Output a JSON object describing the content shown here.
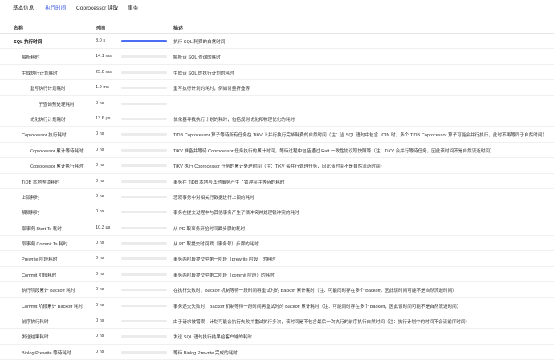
{
  "tabs": [
    {
      "label": "基本信息",
      "active": false
    },
    {
      "label": "执行时间",
      "active": true
    },
    {
      "label": "Coprocessor 读取",
      "active": false
    },
    {
      "label": "事务",
      "active": false
    }
  ],
  "columns": {
    "name": "名称",
    "time": "时间",
    "desc": "描述"
  },
  "accent_color": "#3b5bdb",
  "rows": [
    {
      "name": "SQL 执行时间",
      "time": "8.0 s",
      "progress": 1.0,
      "desc": "执行 SQL 耗费的自然时间",
      "bold": true
    },
    {
      "name": "解析耗时",
      "time": "14.1 ms",
      "progress": 0.0,
      "desc": "解析该 SQL 查询的耗时"
    },
    {
      "name": "生成执行计划耗时",
      "time": "25.0 ms",
      "progress": 0.0,
      "desc": "生成该 SQL 的执行计划的耗时"
    },
    {
      "name": "重写执行计划耗时",
      "time": "1.9 ms",
      "progress": 0.0,
      "desc": "重写执行计划的耗时，例如常量折叠等"
    },
    {
      "name": "子查询预处理耗时",
      "time": "0 ns",
      "progress": 0.0,
      "desc": ""
    },
    {
      "name": "优化执行计划耗时",
      "time": "13.6 µs",
      "progress": 0.0,
      "desc": "优化器寻找执行计划的耗时，包括规则优化和物理优化的耗时"
    },
    {
      "name": "Coprocessor 执行耗时",
      "time": "0 ns",
      "progress": 0.0,
      "desc": "TiDB Coprocessor 算子等待所有任务在 TiKV 上并行执行完毕耗费的自然时间（注：当 SQL 语句中包含 JOIN 时，多个 TiDB Coprocessor 算子可能会并行执行，此时不再等同于自然时间）"
    },
    {
      "name": "Coprocessor 累计等待耗时",
      "time": "0 ns",
      "progress": 0.0,
      "desc": "TiKV 准备并等待 Coprocessor 任务执行的累计时间，等待过程中包括通过 Raft 一致性协议取快照等（注：TiKV 会并行等待任务，因此该时间不是自然流逝时间）"
    },
    {
      "name": "Coprocessor 累计执行耗时",
      "time": "0 ns",
      "progress": 0.0,
      "desc": "TiKV 执行 Coprocessor 任务的累计处理时间（注：TiKV 会并行处理任务，因此该时间不是自然流逝时间）"
    },
    {
      "name": "TiDB 本地等锁耗时",
      "time": "0 ns",
      "progress": 0.0,
      "desc": "事务在 TiDB 本地与其他事务产生了锁冲突并等待的耗时"
    },
    {
      "name": "上锁耗时",
      "time": "0 ns",
      "progress": 0.0,
      "desc": "悲观事务中对相关行数据进行上锁的耗时"
    },
    {
      "name": "解锁耗时",
      "time": "0 ns",
      "progress": 0.0,
      "desc": "事务在提交过程中与其他事务产生了锁冲突并处理锁冲突的耗时"
    },
    {
      "name": "取事务 Start Ts 耗时",
      "time": "10.3 µs",
      "progress": 0.0,
      "desc": "从 PD 取事务开始时间戳步骤的耗时"
    },
    {
      "name": "取事务 Commit Ts 耗时",
      "time": "0 ns",
      "progress": 0.0,
      "desc": "从 PD 取提交时间戳（事务号）步骤的耗时"
    },
    {
      "name": "Prewrite 阶段耗时",
      "time": "0 ns",
      "progress": 0.0,
      "desc": "事务两阶段提交中第一阶段（prewrite 阶段）的耗时"
    },
    {
      "name": "Commit 阶段耗时",
      "time": "0 ns",
      "progress": 0.0,
      "desc": "事务两阶段提交中第二阶段（commit 阶段）的耗时"
    },
    {
      "name": "执行阶段累计 Backoff 耗时",
      "time": "0 ns",
      "progress": 0.0,
      "desc": "在执行失败时，Backoff 机制等待一段时间再重试时的 Backoff 累计耗时（注：可能同时存在多个 Backoff，因此该时间可能不是自然流逝时间）"
    },
    {
      "name": "Commit 阶段累计 Backoff 耗时",
      "time": "0 ns",
      "progress": 0.0,
      "desc": "事务递交失败时，Backoff 机制等待一段时间再重试时的 Backoff 累计耗时（注：可能同时存在多个 Backoff，因此该时间可能不是自然流逝时间）"
    },
    {
      "name": "前序执行耗时",
      "time": "0 ns",
      "progress": 0.0,
      "desc": "由于请求被错误，计划可能会执行失败并重试执行多次，该时间是不包含最后一次执行的前序执行自然时间（注：执行计划中的时间不会该前序时间）"
    },
    {
      "name": "发送结果耗时",
      "time": "0 ns",
      "progress": 0.0,
      "desc": "发送 SQL 语句执行结果给客户端的耗时"
    },
    {
      "name": "Binlog Prewrite 等待耗时",
      "time": "0 ns",
      "progress": 0.0,
      "desc": "等待 Binlog Prewrite 完成的耗时"
    }
  ]
}
